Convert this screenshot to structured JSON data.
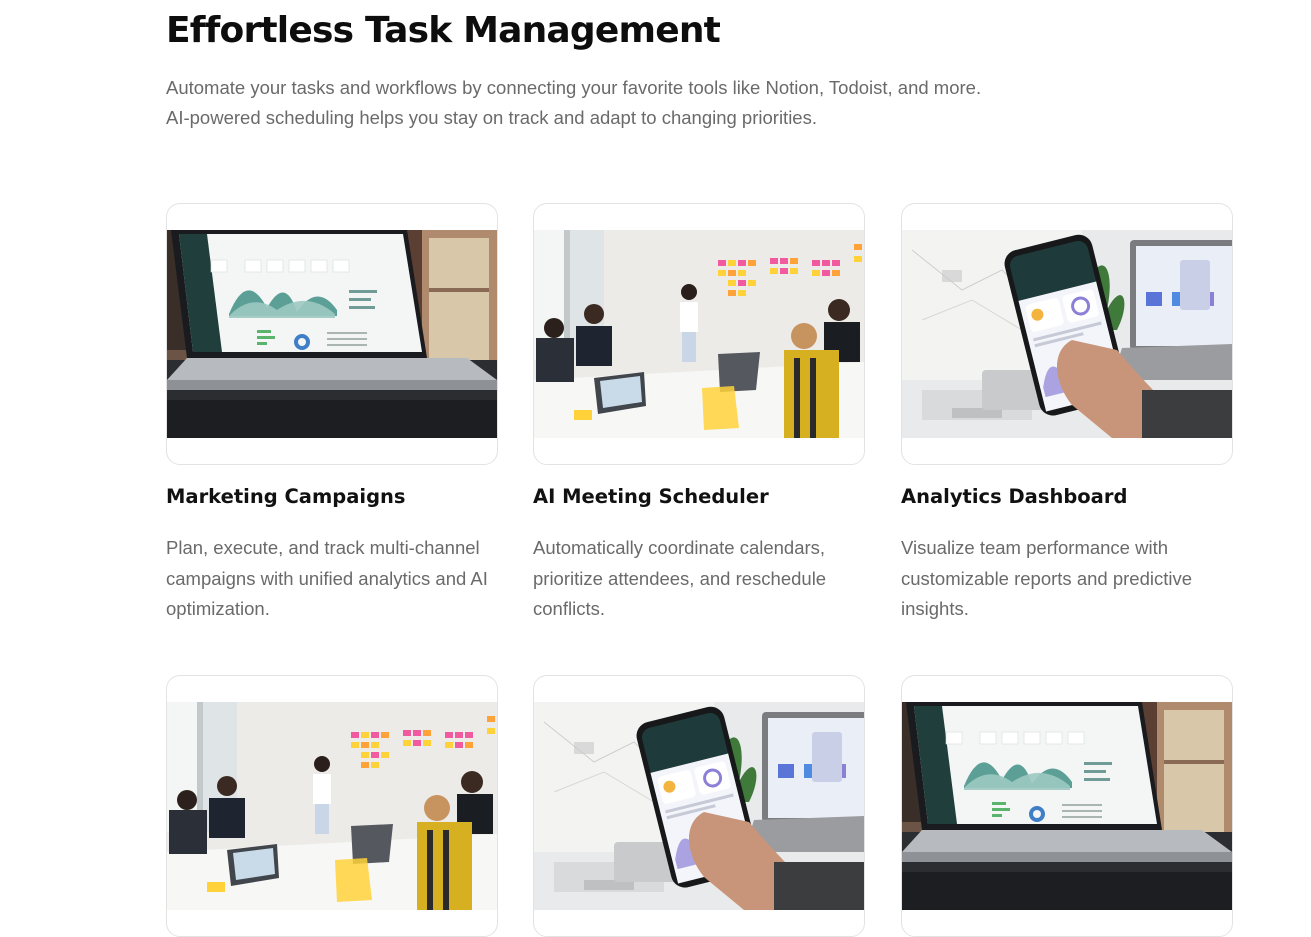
{
  "header": {
    "title": "Effortless Task Management",
    "intro": "Automate your tasks and workflows by connecting your favorite tools like Notion, Todoist, and more. AI-powered scheduling helps you stay on track and adapt to changing priorities."
  },
  "cards": [
    {
      "title": "Marketing Campaigns",
      "description": "Plan, execute, and track multi-channel campaigns with unified analytics and AI optimization.",
      "image": "laptop-dashboard"
    },
    {
      "title": "AI Meeting Scheduler",
      "description": "Automatically coordinate calendars, prioritize attendees, and reschedule conflicts.",
      "image": "team-meeting"
    },
    {
      "title": "Analytics Dashboard",
      "description": "Visualize team performance with customizable reports and predictive insights.",
      "image": "phone-app"
    },
    {
      "title": "",
      "description": "",
      "image": "team-meeting"
    },
    {
      "title": "",
      "description": "",
      "image": "phone-app"
    },
    {
      "title": "",
      "description": "",
      "image": "laptop-dashboard"
    }
  ],
  "image_text": {
    "dashboard_numbers": [
      "2500",
      "1.51",
      "2,500",
      "4,367",
      "2,315",
      "1,201"
    ],
    "phone_greeting": "Hey Baldes!",
    "phone_temp": "17°",
    "phone_count": "87"
  },
  "colors": {
    "title": "#0d0d0d",
    "body_text": "#6a6a6a",
    "card_border": "#e3e3e3",
    "chart_teal": "#3f8f86",
    "sticky_pink": "#f25aa0",
    "sticky_yellow": "#ffd23a",
    "phone_screen_dark": "#1f3a3a",
    "phone_chart_purple": "#8b7fd6"
  }
}
